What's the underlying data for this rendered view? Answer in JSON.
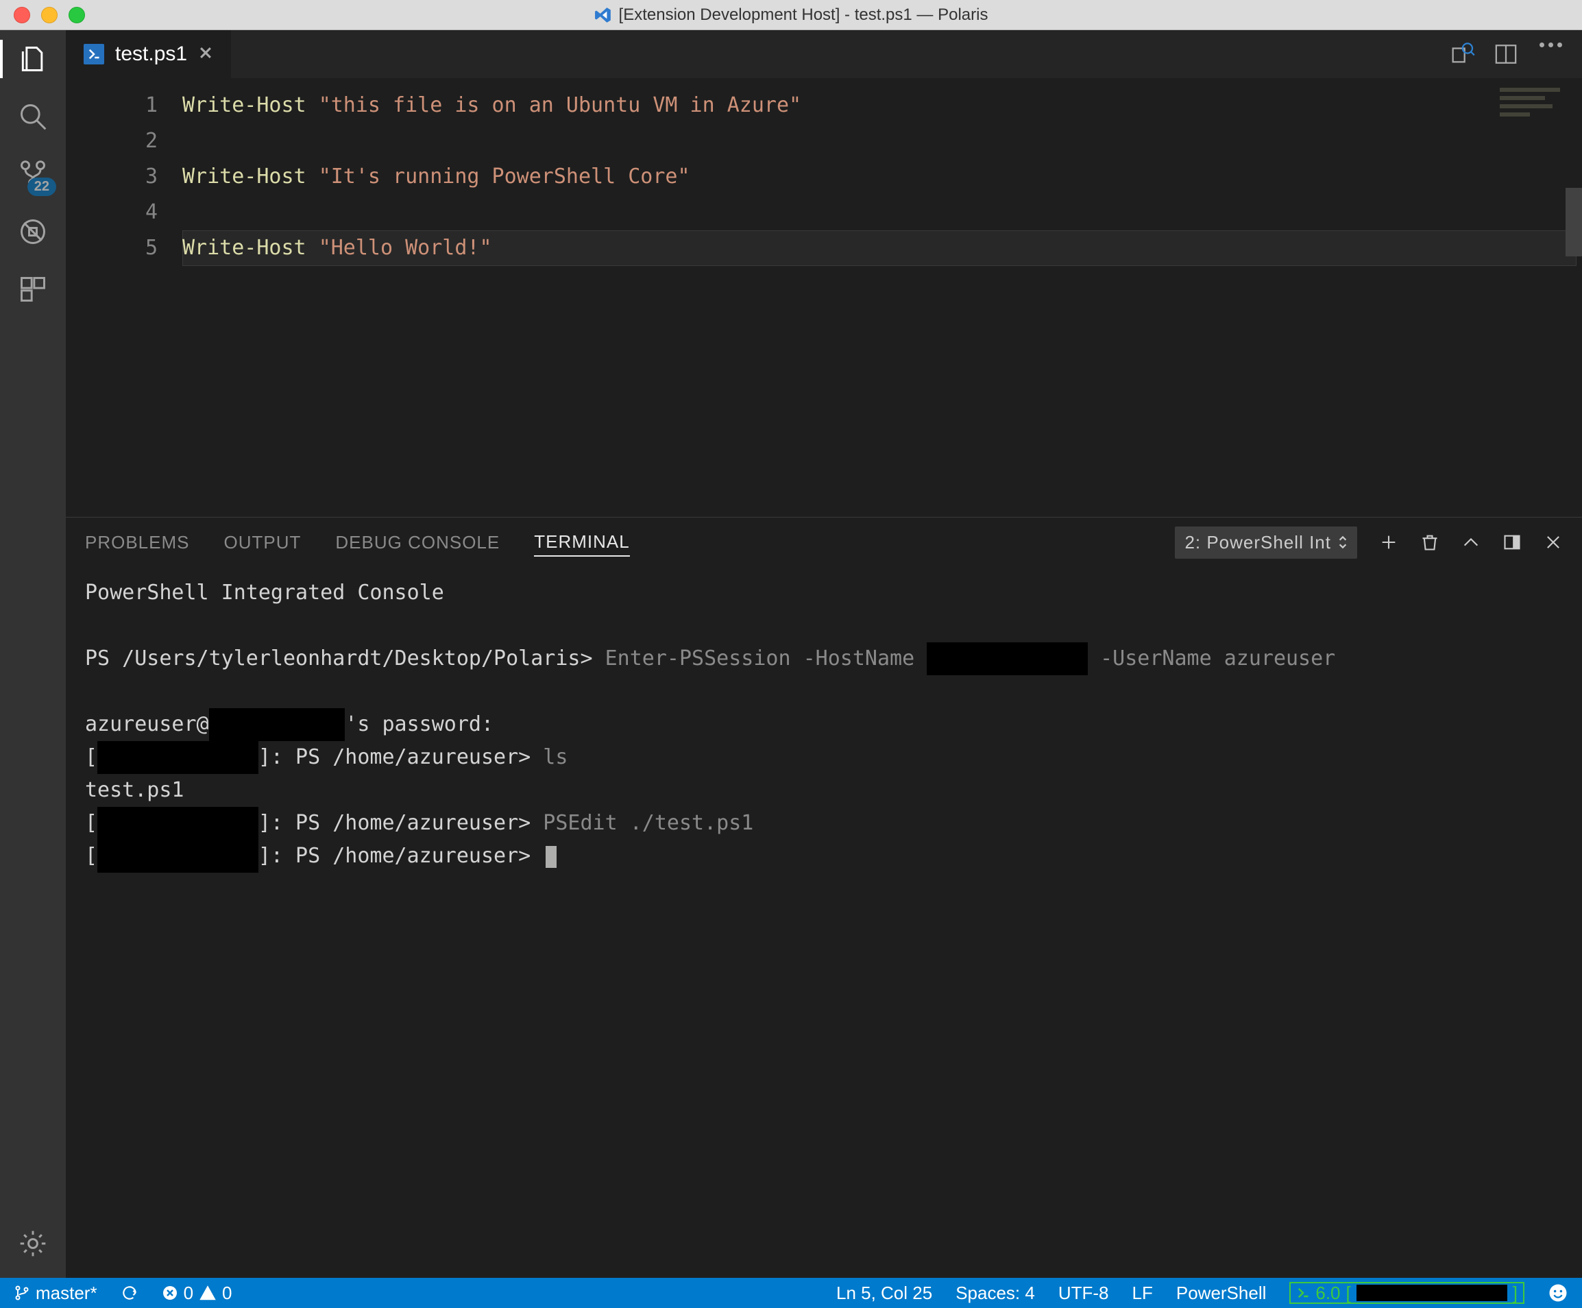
{
  "window": {
    "title": "[Extension Development Host] - test.ps1 — Polaris"
  },
  "activity": {
    "badge": "22"
  },
  "tabs": {
    "file": "test.ps1"
  },
  "editor": {
    "lines": [
      "1",
      "2",
      "3",
      "4",
      "5"
    ],
    "l1_cmd": "Write-Host",
    "l1_str": "\"this file is on an Ubuntu VM in Azure\"",
    "l3_cmd": "Write-Host",
    "l3_str": "\"It's running PowerShell Core\"",
    "l5_cmd": "Write-Host",
    "l5_str": "\"Hello World!\""
  },
  "panel": {
    "tabs": {
      "problems": "PROBLEMS",
      "output": "OUTPUT",
      "debug": "DEBUG CONSOLE",
      "terminal": "TERMINAL"
    },
    "selector": "2: PowerShell Int"
  },
  "terminal": {
    "banner": "PowerShell Integrated Console",
    "prompt1a": "PS /Users/tylerleonhardt/Desktop/Polaris>",
    "prompt1b": "Enter-PSSession -HostName ",
    "prompt1c": " -UserName azureuser",
    "pw_a": "azureuser@",
    "pw_b": "'s password:",
    "rp_open": "[",
    "rp_close": "]: PS /home/azureuser>",
    "ls": " ls",
    "lsout": "test.ps1",
    "psedit": " PSEdit ./test.ps1"
  },
  "status": {
    "branch": "master*",
    "err": "0",
    "warn": "0",
    "lncol": "Ln 5, Col 25",
    "spaces": "Spaces: 4",
    "enc": "UTF-8",
    "eol": "LF",
    "lang": "PowerShell",
    "psver": "6.0"
  }
}
